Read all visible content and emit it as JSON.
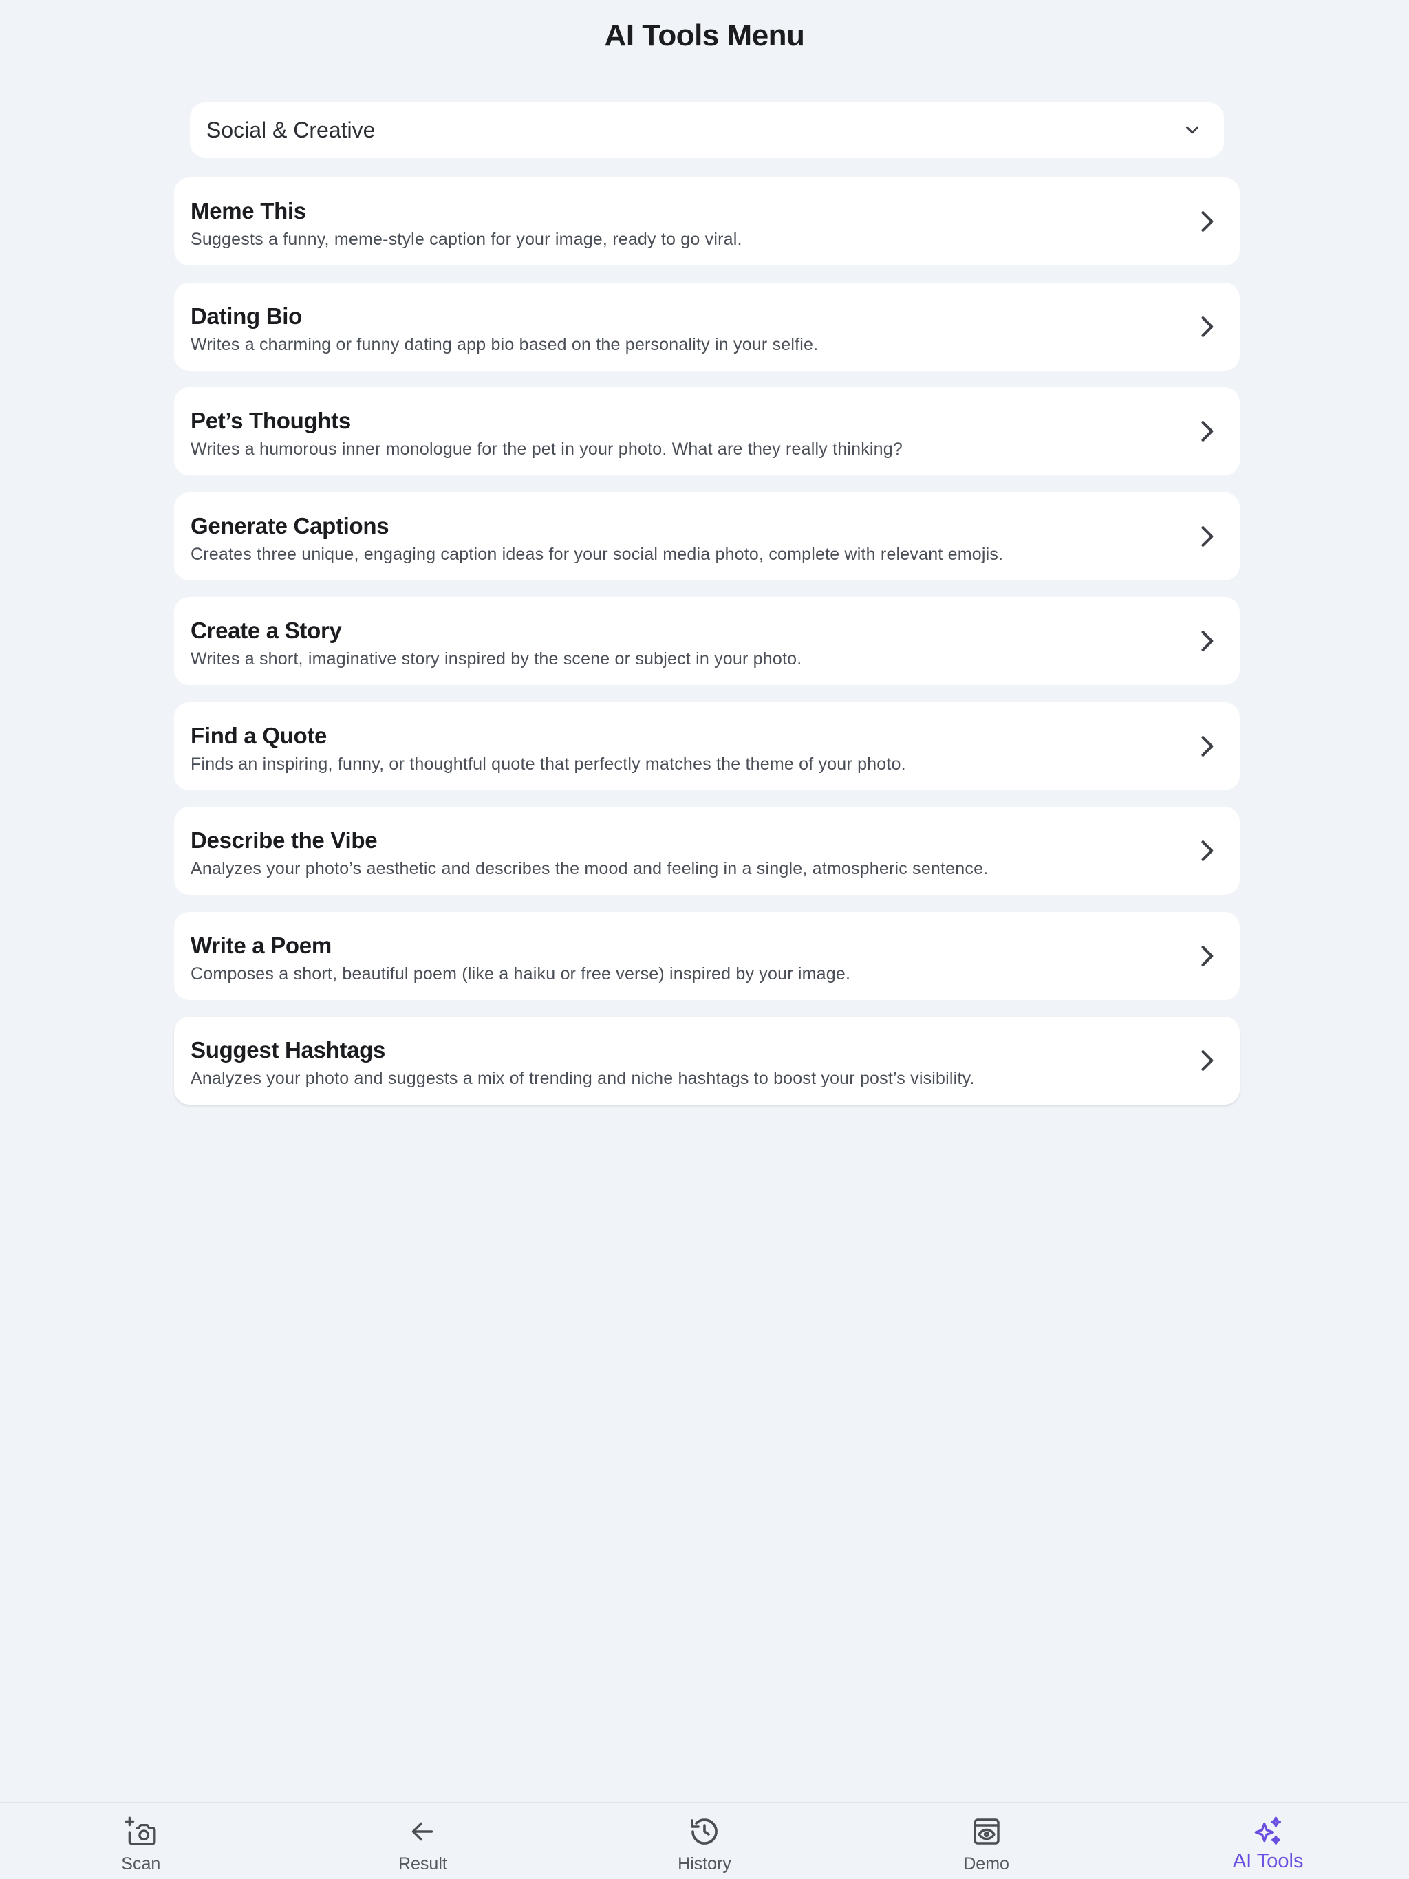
{
  "header": {
    "title": "AI Tools Menu"
  },
  "category": {
    "selected": "Social & Creative"
  },
  "tools": [
    {
      "title": "Meme This",
      "description": "Suggests a funny, meme-style caption for your image, ready to go viral."
    },
    {
      "title": "Dating Bio",
      "description": "Writes a charming or funny dating app bio based on the personality in your selfie."
    },
    {
      "title": "Pet’s Thoughts",
      "description": "Writes a humorous inner monologue for the pet in your photo. What are they really thinking?"
    },
    {
      "title": "Generate Captions",
      "description": "Creates three unique, engaging caption ideas for your social media photo, complete with relevant emojis."
    },
    {
      "title": "Create a Story",
      "description": "Writes a short, imaginative story inspired by the scene or subject in your photo."
    },
    {
      "title": "Find a Quote",
      "description": "Finds an inspiring, funny, or thoughtful quote that perfectly matches the theme of your photo."
    },
    {
      "title": "Describe the Vibe",
      "description": "Analyzes your photo’s aesthetic and describes the mood and feeling in a single, atmospheric sentence."
    },
    {
      "title": "Write a Poem",
      "description": "Composes a short, beautiful poem (like a haiku or free verse) inspired by your image."
    },
    {
      "title": "Suggest Hashtags",
      "description": "Analyzes your photo and suggests a mix of trending and niche hashtags to boost your post’s visibility."
    }
  ],
  "nav": {
    "items": [
      {
        "label": "Scan",
        "icon": "camera-plus-icon"
      },
      {
        "label": "Result",
        "icon": "arrow-left-icon"
      },
      {
        "label": "History",
        "icon": "history-icon"
      },
      {
        "label": "Demo",
        "icon": "demo-eye-icon"
      },
      {
        "label": "AI Tools",
        "icon": "sparkles-icon"
      }
    ],
    "active": "AI Tools"
  },
  "colors": {
    "background": "#f0f3f8",
    "card": "#ffffff",
    "accent": "#6a4ee0",
    "text": "#1a1c20",
    "muted": "#4a4f57"
  }
}
